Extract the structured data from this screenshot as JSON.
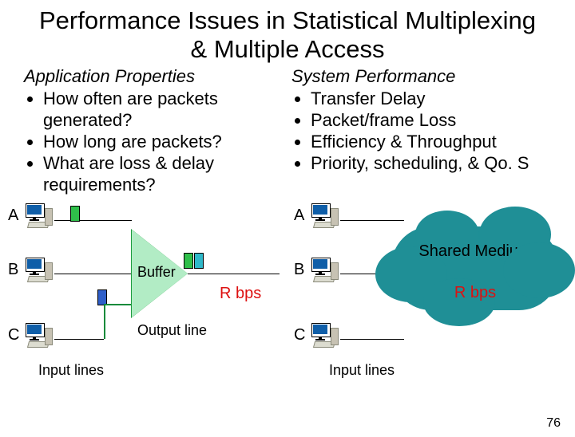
{
  "title": "Performance Issues in Statistical Multiplexing & Multiple Access",
  "left": {
    "header": "Application Properties",
    "items": [
      "How often are packets generated?",
      "How long are packets?",
      "What are loss & delay requirements?"
    ]
  },
  "right": {
    "header": "System Performance",
    "items": [
      "Transfer Delay",
      "Packet/frame Loss",
      "Efficiency & Throughput",
      "Priority, scheduling, & Qo. S"
    ]
  },
  "diagram_left": {
    "buffer_label": "Buffer",
    "rbps": "R bps",
    "output_line": "Output line",
    "input_lines": "Input lines",
    "nodes": [
      "A",
      "B",
      "C"
    ]
  },
  "diagram_right": {
    "shared_medium": "Shared Medium",
    "rbps": "R bps",
    "input_lines": "Input lines",
    "nodes": [
      "A",
      "B",
      "C"
    ]
  },
  "page_number": "76"
}
